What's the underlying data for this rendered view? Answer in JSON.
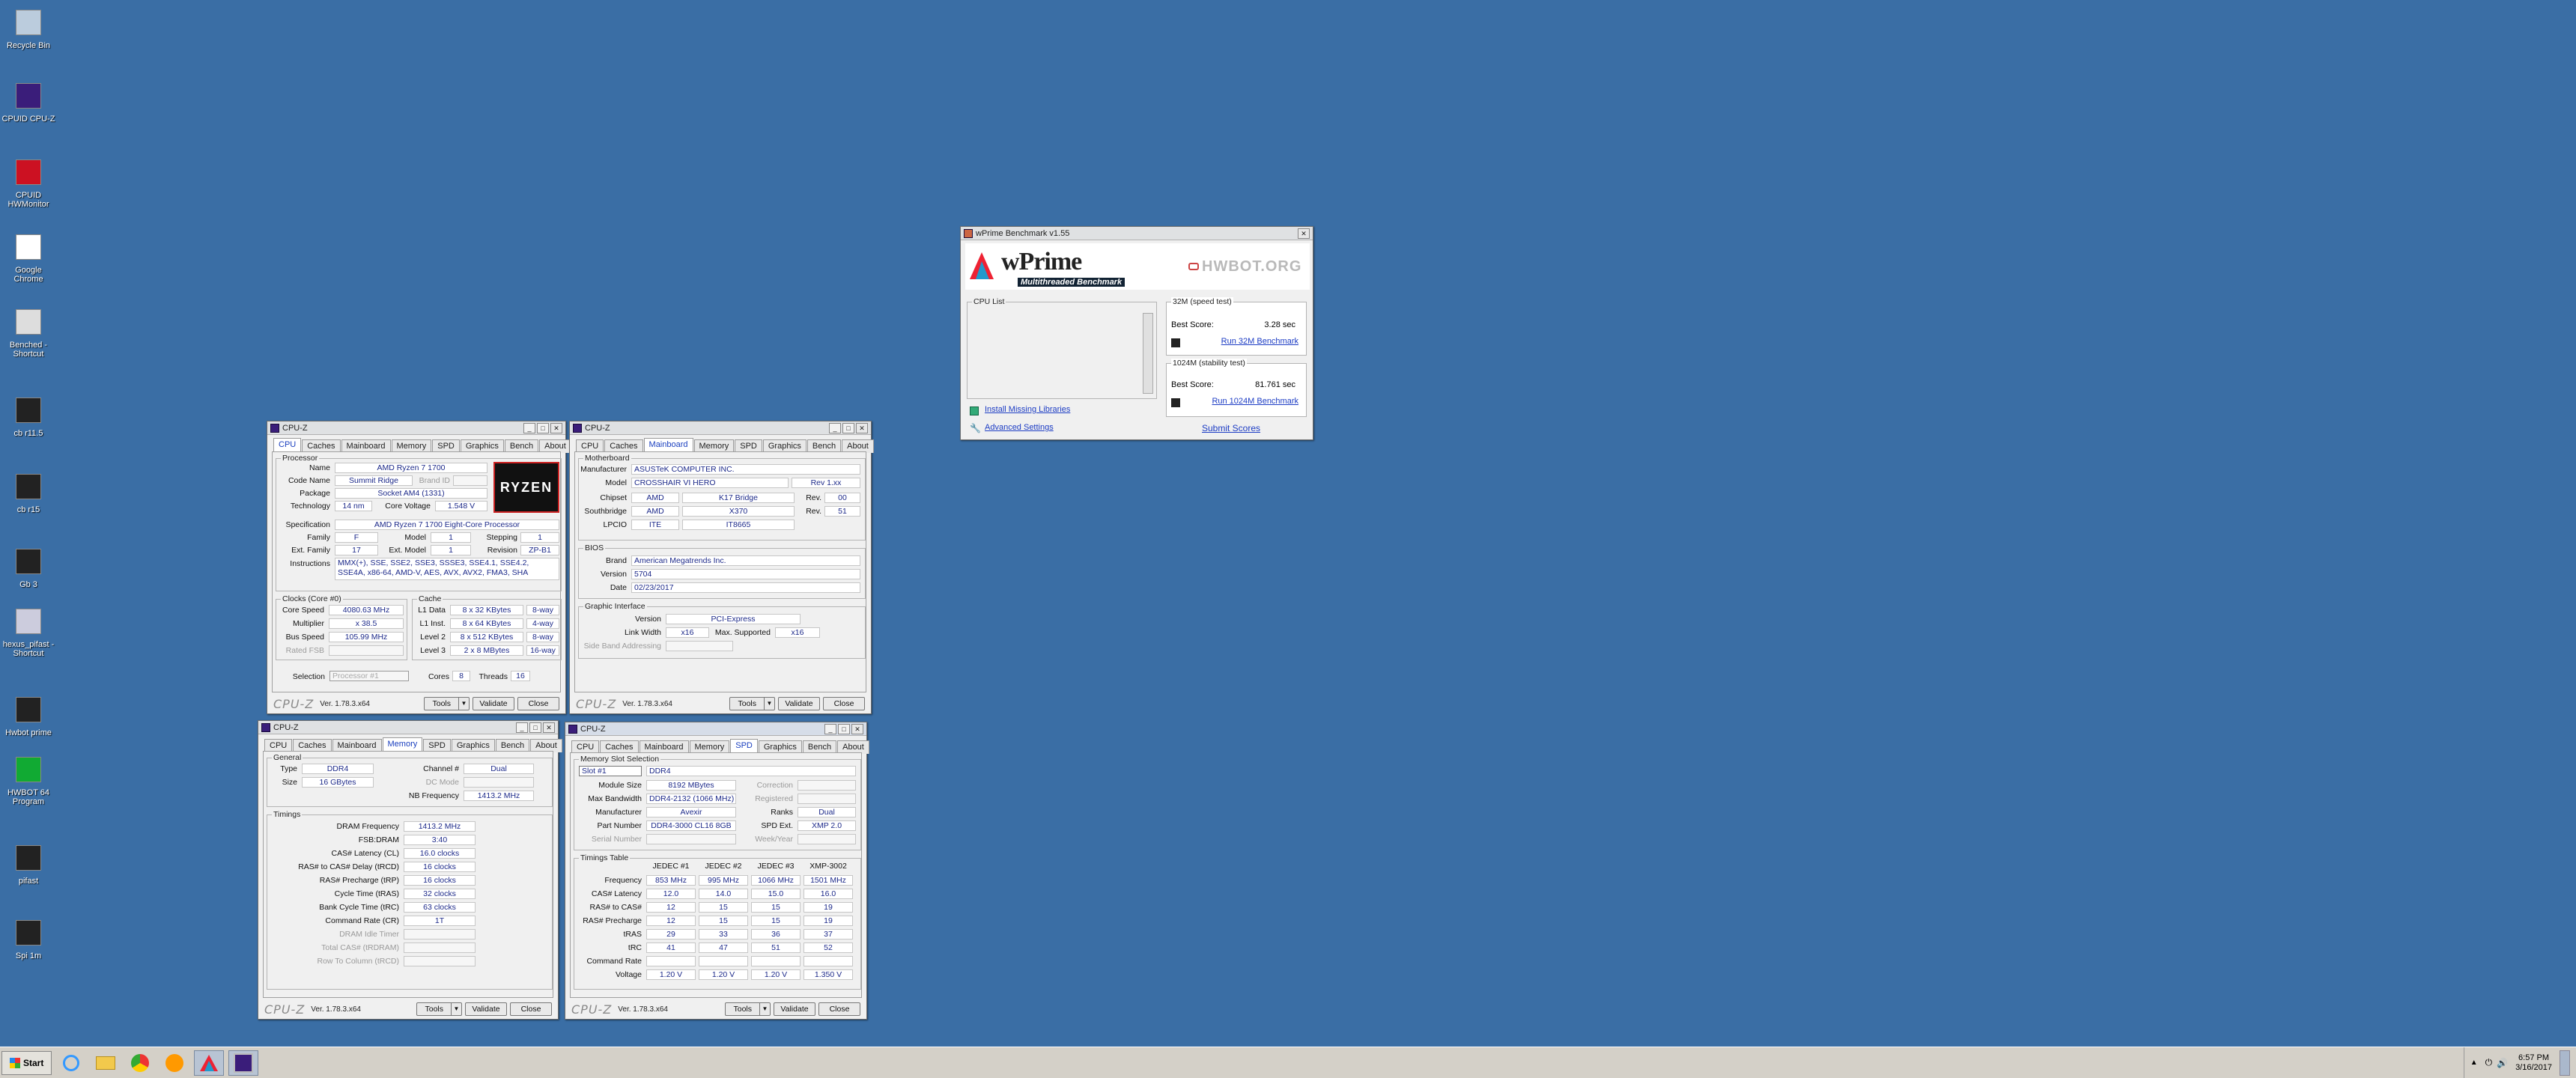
{
  "desktop": {
    "icons": [
      "Recycle Bin",
      "CPUID CPU-Z",
      "CPUID HWMonitor",
      "Google Chrome",
      "Benched - Shortcut",
      "cb r11.5",
      "cb r15",
      "Gb 3",
      "hexus_pifast - Shortcut",
      "Hwbot prime",
      "HWBOT 64 Program",
      "pifast",
      "Spi 1m"
    ]
  },
  "cpuz_cpu": {
    "title": "CPU-Z",
    "tabs": [
      "CPU",
      "Caches",
      "Mainboard",
      "Memory",
      "SPD",
      "Graphics",
      "Bench",
      "About"
    ],
    "processor_label": "Processor",
    "name_l": "Name",
    "name": "AMD Ryzen 7 1700",
    "code_l": "Code Name",
    "code": "Summit Ridge",
    "brand_id_l": "Brand ID",
    "pkg_l": "Package",
    "pkg": "Socket AM4 (1331)",
    "tech_l": "Technology",
    "tech": "14 nm",
    "cv_l": "Core Voltage",
    "cv": "1.548 V",
    "spec_l": "Specification",
    "spec": "AMD Ryzen 7 1700 Eight-Core Processor",
    "family_l": "Family",
    "family": "F",
    "model_l": "Model",
    "model": "1",
    "step_l": "Stepping",
    "step": "1",
    "extf_l": "Ext. Family",
    "extf": "17",
    "extm_l": "Ext. Model",
    "extm": "1",
    "rev_l": "Revision",
    "rev": "ZP-B1",
    "instr_l": "Instructions",
    "instr": "MMX(+), SSE, SSE2, SSE3, SSSE3, SSE4.1, SSE4.2, SSE4A, x86-64, AMD-V, AES, AVX, AVX2, FMA3, SHA",
    "clocks_label": "Clocks (Core #0)",
    "cs_l": "Core Speed",
    "cs": "4080.63 MHz",
    "mult_l": "Multiplier",
    "mult": "x 38.5",
    "bus_l": "Bus Speed",
    "bus": "105.99 MHz",
    "fsb_l": "Rated FSB",
    "cache_label": "Cache",
    "l1d_l": "L1 Data",
    "l1d": "8 x 32 KBytes",
    "l1d_w": "8-way",
    "l1i_l": "L1 Inst.",
    "l1i": "8 x 64 KBytes",
    "l1i_w": "4-way",
    "l2_l": "Level 2",
    "l2": "8 x 512 KBytes",
    "l2_w": "8-way",
    "l3_l": "Level 3",
    "l3": "2 x 8 MBytes",
    "l3_w": "16-way",
    "sel_l": "Selection",
    "sel": "Processor #1",
    "cores_l": "Cores",
    "cores": "8",
    "thr_l": "Threads",
    "thr": "16",
    "logo_text": "RYZEN"
  },
  "cpuz_mb": {
    "title": "CPU-Z",
    "tabs": [
      "CPU",
      "Caches",
      "Mainboard",
      "Memory",
      "SPD",
      "Graphics",
      "Bench",
      "About"
    ],
    "mb_label": "Motherboard",
    "man_l": "Manufacturer",
    "man": "ASUSTeK COMPUTER INC.",
    "model_l": "Model",
    "model": "CROSSHAIR VI HERO",
    "model_rev": "Rev 1.xx",
    "chip_l": "Chipset",
    "chip": "AMD",
    "chip2": "K17 Bridge",
    "chip_rev_l": "Rev.",
    "chip_rev": "00",
    "south_l": "Southbridge",
    "south": "AMD",
    "south2": "X370",
    "south_rev_l": "Rev.",
    "south_rev": "51",
    "lpc_l": "LPCIO",
    "lpc": "ITE",
    "lpc2": "IT8665",
    "bios_label": "BIOS",
    "brand_l": "Brand",
    "brand": "American Megatrends Inc.",
    "ver_l": "Version",
    "ver": "5704",
    "date_l": "Date",
    "date": "02/23/2017",
    "gi_label": "Graphic Interface",
    "giv_l": "Version",
    "giv": "PCI-Express",
    "lw_l": "Link Width",
    "lw": "x16",
    "ms_l": "Max. Supported",
    "ms": "x16",
    "sba_l": "Side Band Addressing"
  },
  "cpuz_mem": {
    "title": "CPU-Z",
    "tabs": [
      "CPU",
      "Caches",
      "Mainboard",
      "Memory",
      "SPD",
      "Graphics",
      "Bench",
      "About"
    ],
    "gen_label": "General",
    "type_l": "Type",
    "type": "DDR4",
    "ch_l": "Channel #",
    "ch": "Dual",
    "size_l": "Size",
    "size": "16 GBytes",
    "dc_l": "DC Mode",
    "nb_l": "NB Frequency",
    "nb": "1413.2 MHz",
    "tim_label": "Timings",
    "rows": [
      {
        "l": "DRAM Frequency",
        "v": "1413.2 MHz"
      },
      {
        "l": "FSB:DRAM",
        "v": "3:40"
      },
      {
        "l": "CAS# Latency (CL)",
        "v": "16.0 clocks"
      },
      {
        "l": "RAS# to CAS# Delay (tRCD)",
        "v": "16 clocks"
      },
      {
        "l": "RAS# Precharge (tRP)",
        "v": "16 clocks"
      },
      {
        "l": "Cycle Time (tRAS)",
        "v": "32 clocks"
      },
      {
        "l": "Bank Cycle Time (tRC)",
        "v": "63 clocks"
      },
      {
        "l": "Command Rate (CR)",
        "v": "1T"
      }
    ],
    "dim_rows": [
      "DRAM Idle Timer",
      "Total CAS# (tRDRAM)",
      "Row To Column (tRCD)"
    ]
  },
  "cpuz_spd": {
    "title": "CPU-Z",
    "tabs": [
      "CPU",
      "Caches",
      "Mainboard",
      "Memory",
      "SPD",
      "Graphics",
      "Bench",
      "About"
    ],
    "slot_label": "Memory Slot Selection",
    "slot": "Slot #1",
    "slot_type": "DDR4",
    "msz_l": "Module Size",
    "msz": "8192 MBytes",
    "corr_l": "Correction",
    "bw_l": "Max Bandwidth",
    "bw": "DDR4-2132 (1066 MHz)",
    "reg_l": "Registered",
    "man_l": "Manufacturer",
    "man": "Avexir",
    "ranks_l": "Ranks",
    "ranks": "Dual",
    "pn_l": "Part Number",
    "pn": "DDR4-3000 CL16 8GB",
    "spdx_l": "SPD Ext.",
    "spdx": "XMP 2.0",
    "sn_l": "Serial Number",
    "wy_l": "Week/Year",
    "tt_label": "Timings Table",
    "cols": [
      "JEDEC #1",
      "JEDEC #2",
      "JEDEC #3",
      "XMP-3002"
    ],
    "rows": [
      {
        "l": "Frequency",
        "v": [
          "853 MHz",
          "995 MHz",
          "1066 MHz",
          "1501 MHz"
        ]
      },
      {
        "l": "CAS# Latency",
        "v": [
          "12.0",
          "14.0",
          "15.0",
          "16.0"
        ]
      },
      {
        "l": "RAS# to CAS#",
        "v": [
          "12",
          "15",
          "15",
          "19"
        ]
      },
      {
        "l": "RAS# Precharge",
        "v": [
          "12",
          "15",
          "15",
          "19"
        ]
      },
      {
        "l": "tRAS",
        "v": [
          "29",
          "33",
          "36",
          "37"
        ]
      },
      {
        "l": "tRC",
        "v": [
          "41",
          "47",
          "51",
          "52"
        ]
      },
      {
        "l": "Command Rate",
        "v": [
          "",
          "",
          "",
          ""
        ]
      },
      {
        "l": "Voltage",
        "v": [
          "1.20 V",
          "1.20 V",
          "1.20 V",
          "1.350 V"
        ]
      }
    ]
  },
  "footer": {
    "logo": "CPU-Z",
    "ver": "Ver. 1.78.3.x64",
    "tools": "Tools",
    "validate": "Validate",
    "close": "Close"
  },
  "wprime": {
    "title": "wPrime Benchmark v1.55",
    "logo": "wPrime",
    "tagline": "Multithreaded Benchmark",
    "hwbot": "HWBOT.ORG",
    "cpu_list": "CPU List",
    "g32": "32M (speed test)",
    "best_l": "Best Score:",
    "best32": "3.28 sec",
    "run32": "Run 32M Benchmark",
    "g1024": "1024M (stability test)",
    "best1024": "81.761 sec",
    "run1024": "Run 1024M Benchmark",
    "install": "Install Missing Libraries",
    "adv": "Advanced Settings",
    "submit": "Submit Scores"
  },
  "taskbar": {
    "start": "Start",
    "time": "6:57 PM",
    "date": "3/16/2017"
  }
}
